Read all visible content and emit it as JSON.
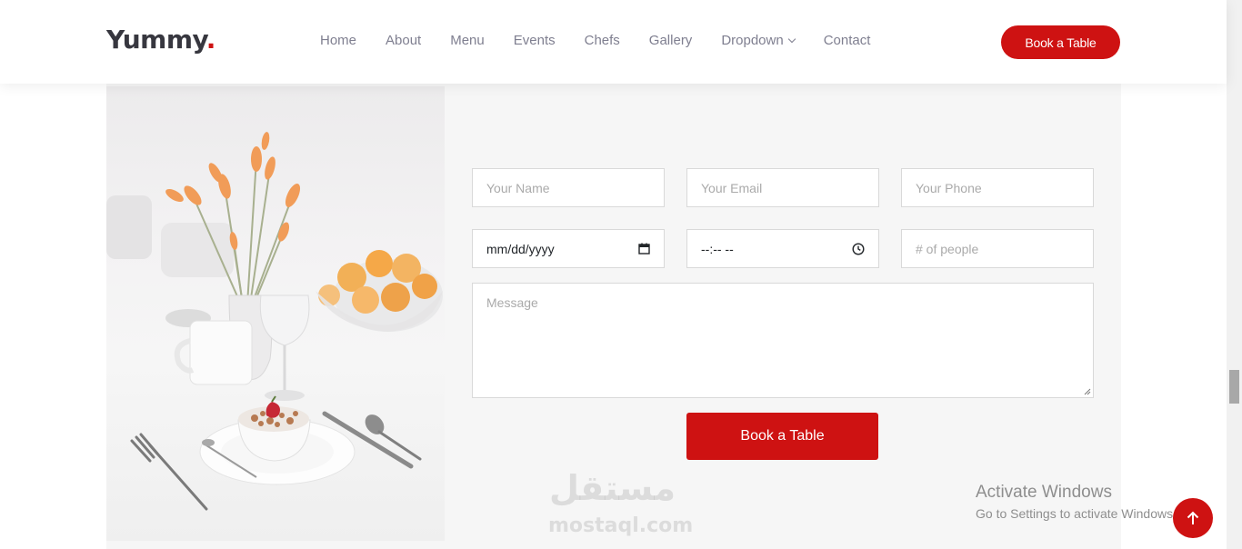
{
  "brand": {
    "name": "Yummy",
    "dot": "."
  },
  "nav": {
    "items": [
      {
        "label": "Home"
      },
      {
        "label": "About"
      },
      {
        "label": "Menu"
      },
      {
        "label": "Events"
      },
      {
        "label": "Chefs"
      },
      {
        "label": "Gallery"
      },
      {
        "label": "Dropdown"
      },
      {
        "label": "Contact"
      }
    ],
    "cta": "Book a Table"
  },
  "form": {
    "name_placeholder": "Your Name",
    "email_placeholder": "Your Email",
    "phone_placeholder": "Your Phone",
    "date_value": "mm/dd/yyyy",
    "time_value": "--:-- --",
    "people_placeholder": "# of people",
    "message_placeholder": "Message",
    "submit_label": "Book a Table"
  },
  "watermark": {
    "arabic": "مستقل",
    "url": "mostaql.com"
  },
  "activate_windows": {
    "title": "Activate Windows",
    "subtitle": "Go to Settings to activate Windows."
  },
  "colors": {
    "accent": "#ce1212",
    "nav_text": "#7f7f90",
    "brand_text": "#37373f"
  }
}
